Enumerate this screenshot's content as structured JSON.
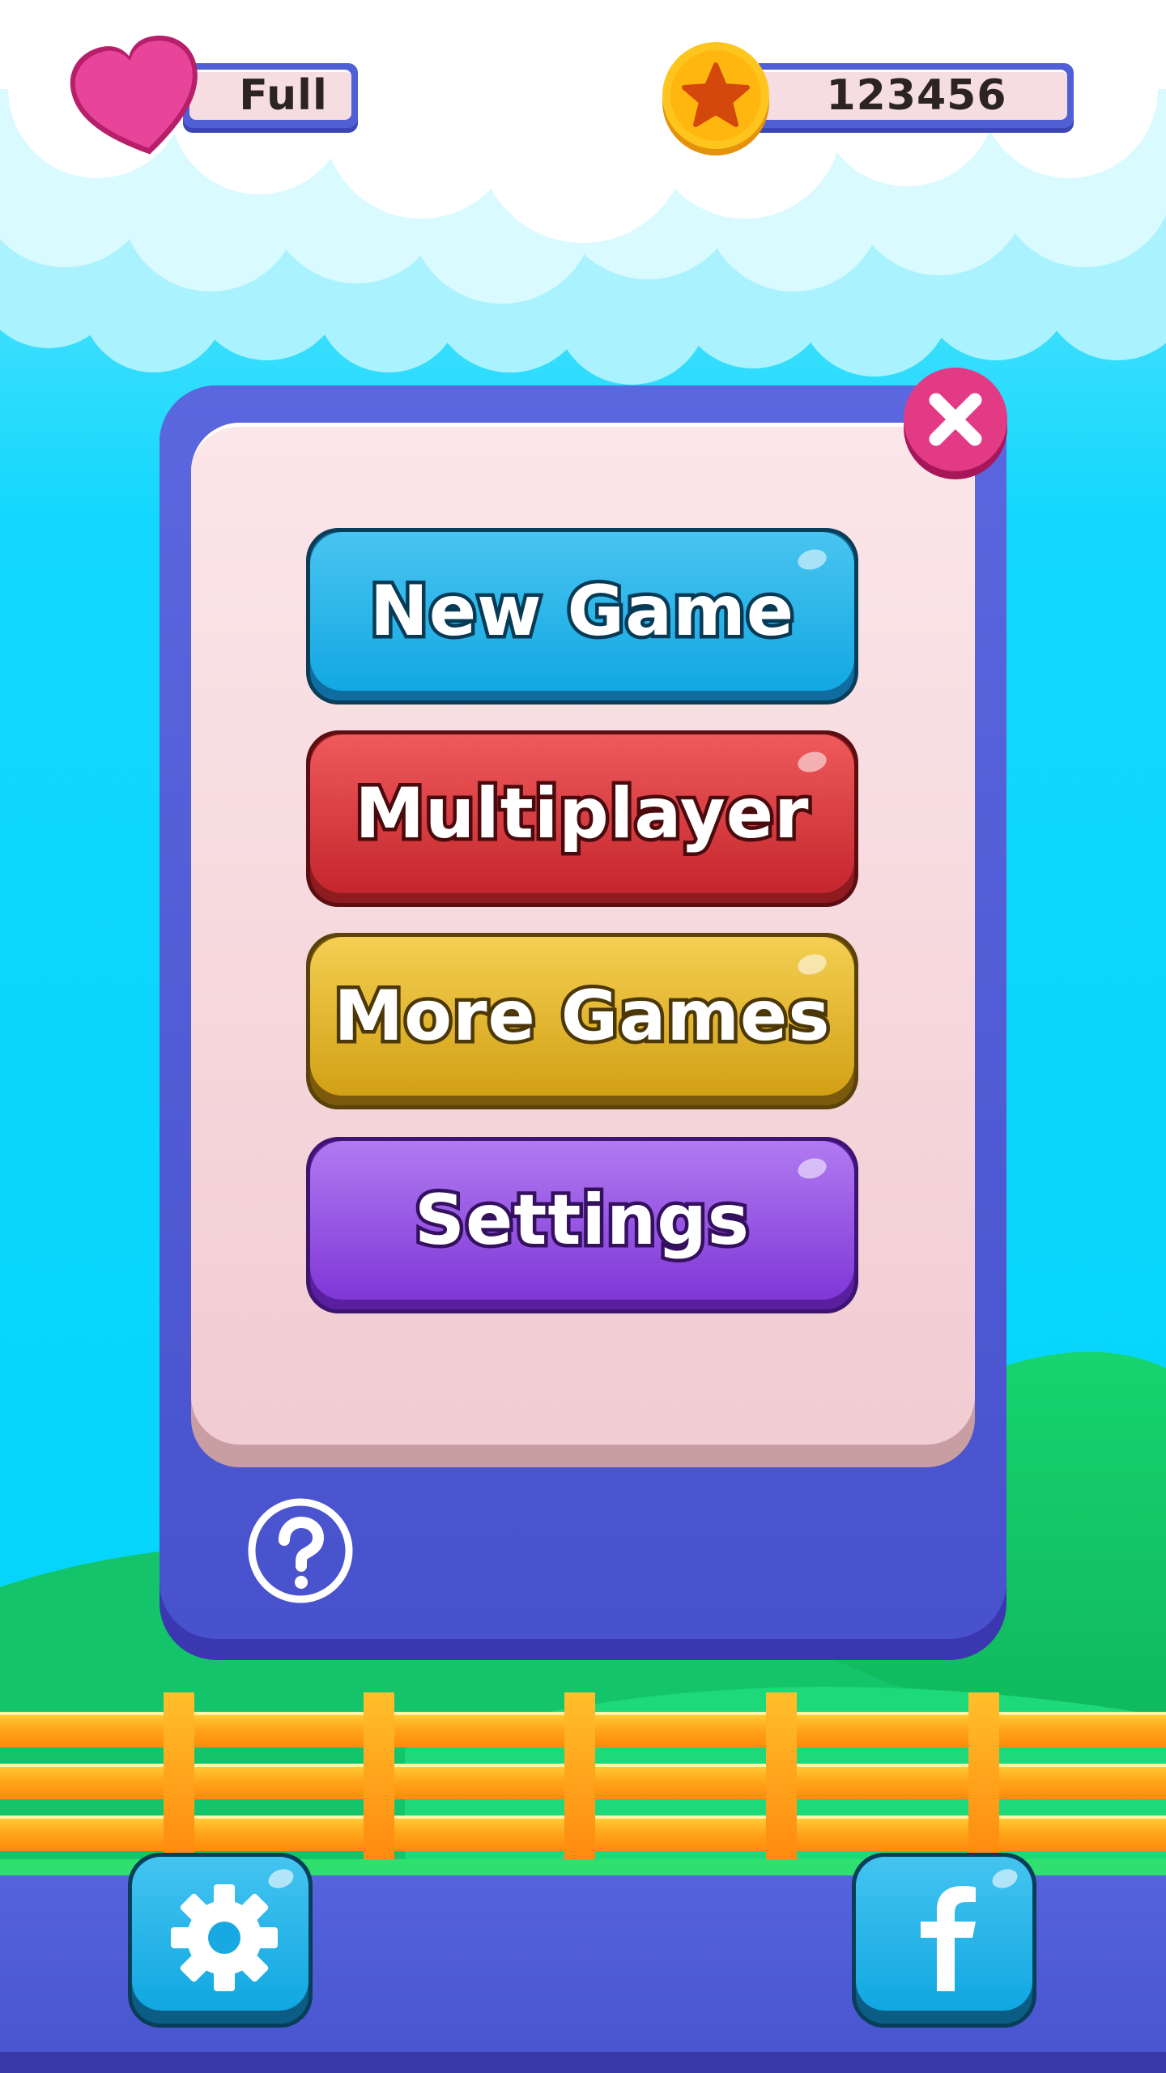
{
  "hud": {
    "lives_label": "Full",
    "coins_value": "123456",
    "lives_icon": "heart-icon",
    "coins_icon": "star-coin-icon"
  },
  "menu": {
    "close_icon": "close-icon",
    "buttons": [
      {
        "label": "New Game",
        "color": "#12a8e2"
      },
      {
        "label": "Multiplayer",
        "color": "#c4262d"
      },
      {
        "label": "More Games",
        "color": "#d2a015"
      },
      {
        "label": "Settings",
        "color": "#7f37d6"
      }
    ],
    "help_icon": "help-icon"
  },
  "bottom_bar": {
    "settings_icon": "gear-icon",
    "facebook_icon": "facebook-icon"
  },
  "colors": {
    "sky": "#00d5fb",
    "panel": "#4f5fd6",
    "panel_inner": "#f6dde2",
    "hill": "#18cc6a",
    "fence": "#ffa514",
    "ground": "#4f5fd6"
  }
}
